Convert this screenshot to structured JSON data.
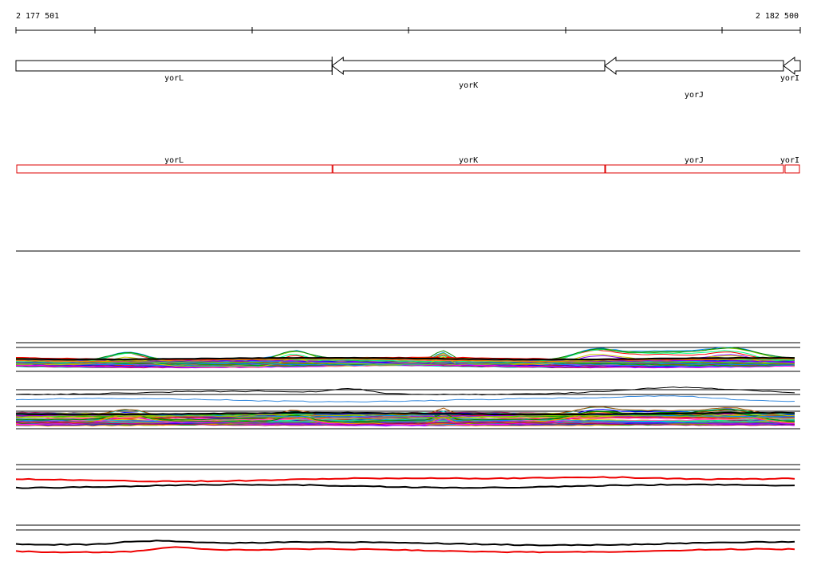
{
  "ruler": {
    "start_label": "2 177 501",
    "end_label": "2 182 500",
    "start": 2177501,
    "end": 2182500
  },
  "genes": [
    {
      "name": "yorL",
      "start": 2177501,
      "end": 2179516,
      "strand": "+"
    },
    {
      "name": "yorK",
      "start": 2179516,
      "end": 2181254,
      "strand": "-"
    },
    {
      "name": "yorJ",
      "start": 2181254,
      "end": 2182393,
      "strand": "-"
    },
    {
      "name": "yorI",
      "start": 2182393,
      "end": 2182500,
      "strand": "-"
    }
  ],
  "colors": {
    "gene_outline": "#000000",
    "annotation_box": "#dd0000",
    "track_line": "#000000",
    "series_red": "#ee0000",
    "series_blue": "#3388dd",
    "series_dark": "#111111"
  },
  "tracks": {
    "expression_profiles_1": {
      "line_count": 60
    },
    "expression_summary_1": {
      "series_colors": [
        "#000000",
        "#3388dd"
      ]
    },
    "expression_profiles_2": {
      "line_count": 60
    },
    "expression_summary_2": {
      "series_colors": [
        "#ee0000",
        "#000000"
      ]
    },
    "expression_summary_3": {
      "series_colors": [
        "#000000",
        "#ee0000"
      ]
    }
  }
}
